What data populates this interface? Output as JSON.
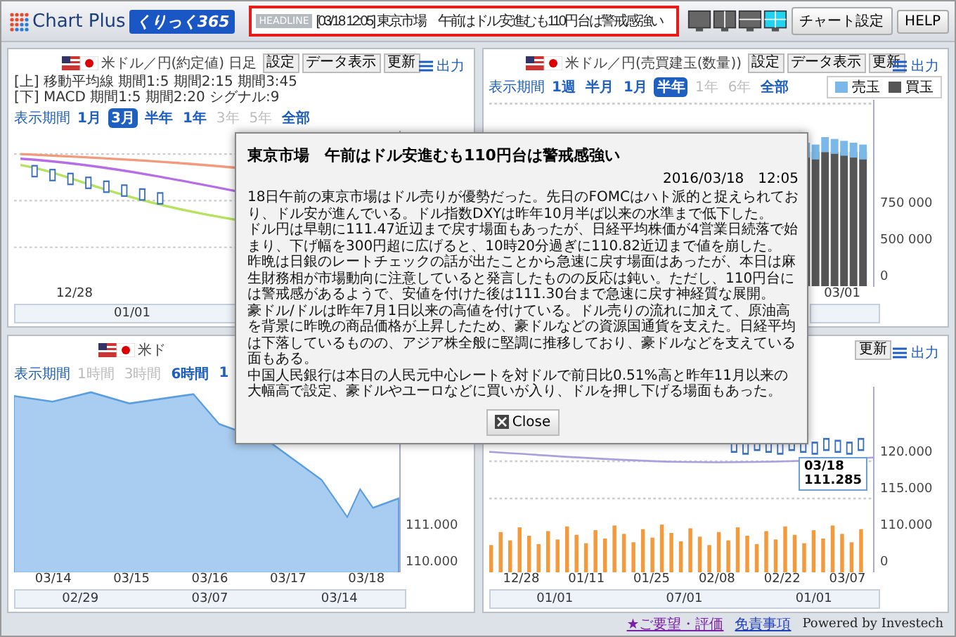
{
  "header": {
    "logo": "Chart Plus",
    "badge": "くりっく365",
    "headline_label": "HEADLINE",
    "headline": "[03/18 12:05] 東京市場　午前はドル安進むも110円台は警戒感強い",
    "layouts": [
      {
        "kind": "single",
        "selected": false
      },
      {
        "kind": "columns",
        "selected": false
      },
      {
        "kind": "rows",
        "selected": false
      },
      {
        "kind": "grid",
        "selected": true
      }
    ],
    "buttons": [
      "チャート設定",
      "HELP"
    ]
  },
  "panels": [
    {
      "kind": "candle",
      "title": "米ドル／円(約定値) 日足",
      "buttons": [
        "設定",
        "データ表示",
        "更新"
      ],
      "export": "出力",
      "indicators": [
        "[上] 移動平均線 期間1:5 期間2:15 期間3:45",
        "[下] MACD 期間1:5 期間2:20 シグナル:9"
      ],
      "period_label": "表示期間",
      "periods": [
        {
          "label": "1月",
          "selected": false,
          "disabled": false
        },
        {
          "label": "3月",
          "selected": true,
          "disabled": false
        },
        {
          "label": "半年",
          "selected": false,
          "disabled": false
        },
        {
          "label": "1年",
          "selected": false,
          "disabled": false
        },
        {
          "label": "3年",
          "selected": false,
          "disabled": true
        },
        {
          "label": "5年",
          "selected": false,
          "disabled": true
        },
        {
          "label": "全部",
          "selected": false,
          "disabled": false
        }
      ],
      "xticks": [
        "12/28"
      ],
      "navigator_labels": [
        "01/01"
      ]
    },
    {
      "kind": "volume",
      "title": "米ドル／円(売買建玉(数量))",
      "buttons": [
        "設定",
        "データ表示",
        "更新"
      ],
      "export": "出力",
      "period_label": "表示期間",
      "periods": [
        {
          "label": "1週",
          "selected": false,
          "disabled": false
        },
        {
          "label": "半月",
          "selected": false,
          "disabled": false
        },
        {
          "label": "1月",
          "selected": false,
          "disabled": false
        },
        {
          "label": "半年",
          "selected": true,
          "disabled": false
        },
        {
          "label": "1年",
          "selected": false,
          "disabled": true
        },
        {
          "label": "6年",
          "selected": false,
          "disabled": true
        },
        {
          "label": "全部",
          "selected": false,
          "disabled": false
        }
      ],
      "legend": [
        {
          "label": "売玉",
          "color": "#7ab8ea"
        },
        {
          "label": "買玉",
          "color": "#555555"
        }
      ],
      "yticks": [
        "750 000",
        "500 000",
        "0"
      ],
      "xticks": [
        "03/01"
      ]
    },
    {
      "kind": "area",
      "title": "米ド",
      "period_label": "表示期間",
      "periods": [
        {
          "label": "1時間",
          "selected": false,
          "disabled": true
        },
        {
          "label": "3時間",
          "selected": false,
          "disabled": true
        },
        {
          "label": "6時間",
          "selected": false,
          "disabled": false
        },
        {
          "label": "1",
          "selected": false,
          "disabled": false
        }
      ],
      "yticks": [
        "111.000",
        "110.000"
      ],
      "xticks": [
        "03/14",
        "03/15",
        "03/16",
        "03/17",
        "03/18"
      ],
      "navigator_labels": [
        "02/29",
        "03/07",
        "03/14"
      ]
    },
    {
      "kind": "candle-volume",
      "buttons": [
        "更新"
      ],
      "export": "出力",
      "yticks": [
        "120.000",
        "115.000",
        "110.000",
        "0"
      ],
      "xticks": [
        "12/28",
        "01/11",
        "01/25",
        "02/08",
        "02/22",
        "03/07"
      ],
      "navigator_labels": [
        "01/01",
        "07/01",
        "01/01"
      ],
      "tooltip": {
        "date": "03/18",
        "value": "111.285"
      }
    }
  ],
  "footer": {
    "links": [
      "★ご要望・評価",
      "免責事項"
    ],
    "powered": "Powered by Investech"
  },
  "modal": {
    "title": "東京市場　午前はドル安進むも110円台は警戒感強い",
    "date": "2016/03/18　12:05",
    "paragraphs": [
      "18日午前の東京市場はドル売りが優勢だった。先日のFOMCはハト派的と捉えられており、ドル安が進んでいる。ドル指数DXYは昨年10月半ば以来の水準まで低下した。",
      " ドル円は早朝に111.47近辺まで戻す場面もあったが、日経平均株価が4営業日続落で始まり、下げ幅を300円超に広げると、10時20分過ぎに110.82近辺まで値を崩した。",
      "昨晩は日銀のレートチェックの話が出たことから急速に戻す場面はあったが、本日は麻生財務相が市場動向に注意していると発言したものの反応は鈍い。ただし、110円台には警戒感があるようで、安値を付けた後は111.30台まで急速に戻す神経質な展開。",
      "豪ドル/ドルは昨年7月1日以来の高値を付けている。ドル売りの流れに加えて、原油高を背景に昨晩の商品価格が上昇したため、豪ドルなどの資源国通貨を支えた。日経平均は下落しているものの、アジア株全般に堅調に推移しており、豪ドルなどを支えている面もある。",
      "中国人民銀行は本日の人民元中心レートを対ドルで前日比0.51%高と昨年11月以来の大幅高で設定、豪ドルやユーロなどに買いが入り、ドルを押し下げる場面もあった。"
    ],
    "close": "Close"
  }
}
